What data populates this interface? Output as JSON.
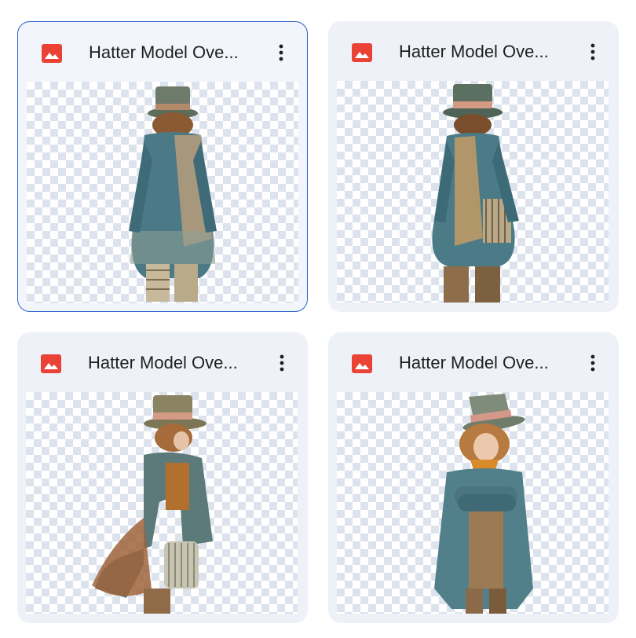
{
  "files": [
    {
      "title": "Hatter Model Ove...",
      "file_icon": "image-file-icon",
      "more_icon": "more-vert-icon",
      "selected": true,
      "thumbnail": "hatter-back-view"
    },
    {
      "title": "Hatter Model Ove...",
      "file_icon": "image-file-icon",
      "more_icon": "more-vert-icon",
      "selected": false,
      "thumbnail": "hatter-back-view-alt"
    },
    {
      "title": "Hatter Model Ove...",
      "file_icon": "image-file-icon",
      "more_icon": "more-vert-icon",
      "selected": false,
      "thumbnail": "hatter-side-view"
    },
    {
      "title": "Hatter Model Ove...",
      "file_icon": "image-file-icon",
      "more_icon": "more-vert-icon",
      "selected": false,
      "thumbnail": "hatter-front-arms-crossed"
    }
  ],
  "colors": {
    "card_background": "#eef1f7",
    "selected_border": "#2b63c9",
    "image_icon_red": "#ea4335",
    "title_text": "#1f1f1f",
    "checker_light": "#ffffff",
    "checker_dark": "#dde3ec"
  }
}
